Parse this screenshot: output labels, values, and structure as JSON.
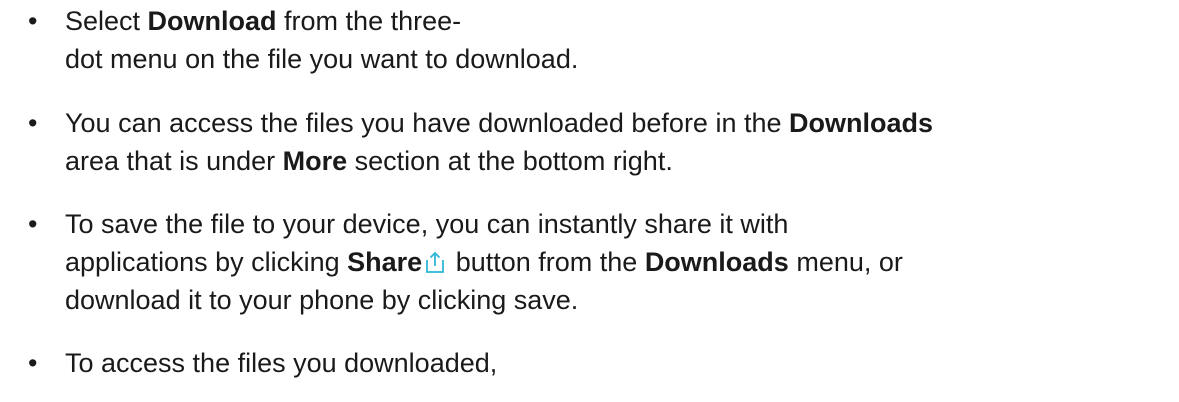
{
  "bullets": [
    {
      "line1_a": "Select ",
      "line1_b": "Download",
      "line1_c": " from the three-",
      "line2": "dot menu on the file you want to download."
    },
    {
      "line1_a": "You can access the files you have downloaded before in the ",
      "line1_b": "Downloads",
      "line2_a": " area that is under ",
      "line2_b": "More",
      "line2_c": " section at the bottom right."
    },
    {
      "line1": "To save the file to your device, you can instantly share it with",
      "line2_a": "applications by clicking ",
      "line2_b": "Share",
      "line2_c": " button from the ",
      "line2_d": "Downloads",
      "line2_e": " menu, or",
      "line3": "download it to your phone by clicking save."
    },
    {
      "line1": "To access the files you downloaded,"
    }
  ],
  "bullet_symbol": "•",
  "icons": {
    "share": "share-icon"
  },
  "colors": {
    "text": "#1a1a1a",
    "icon_accent": "#2bb7d6"
  }
}
